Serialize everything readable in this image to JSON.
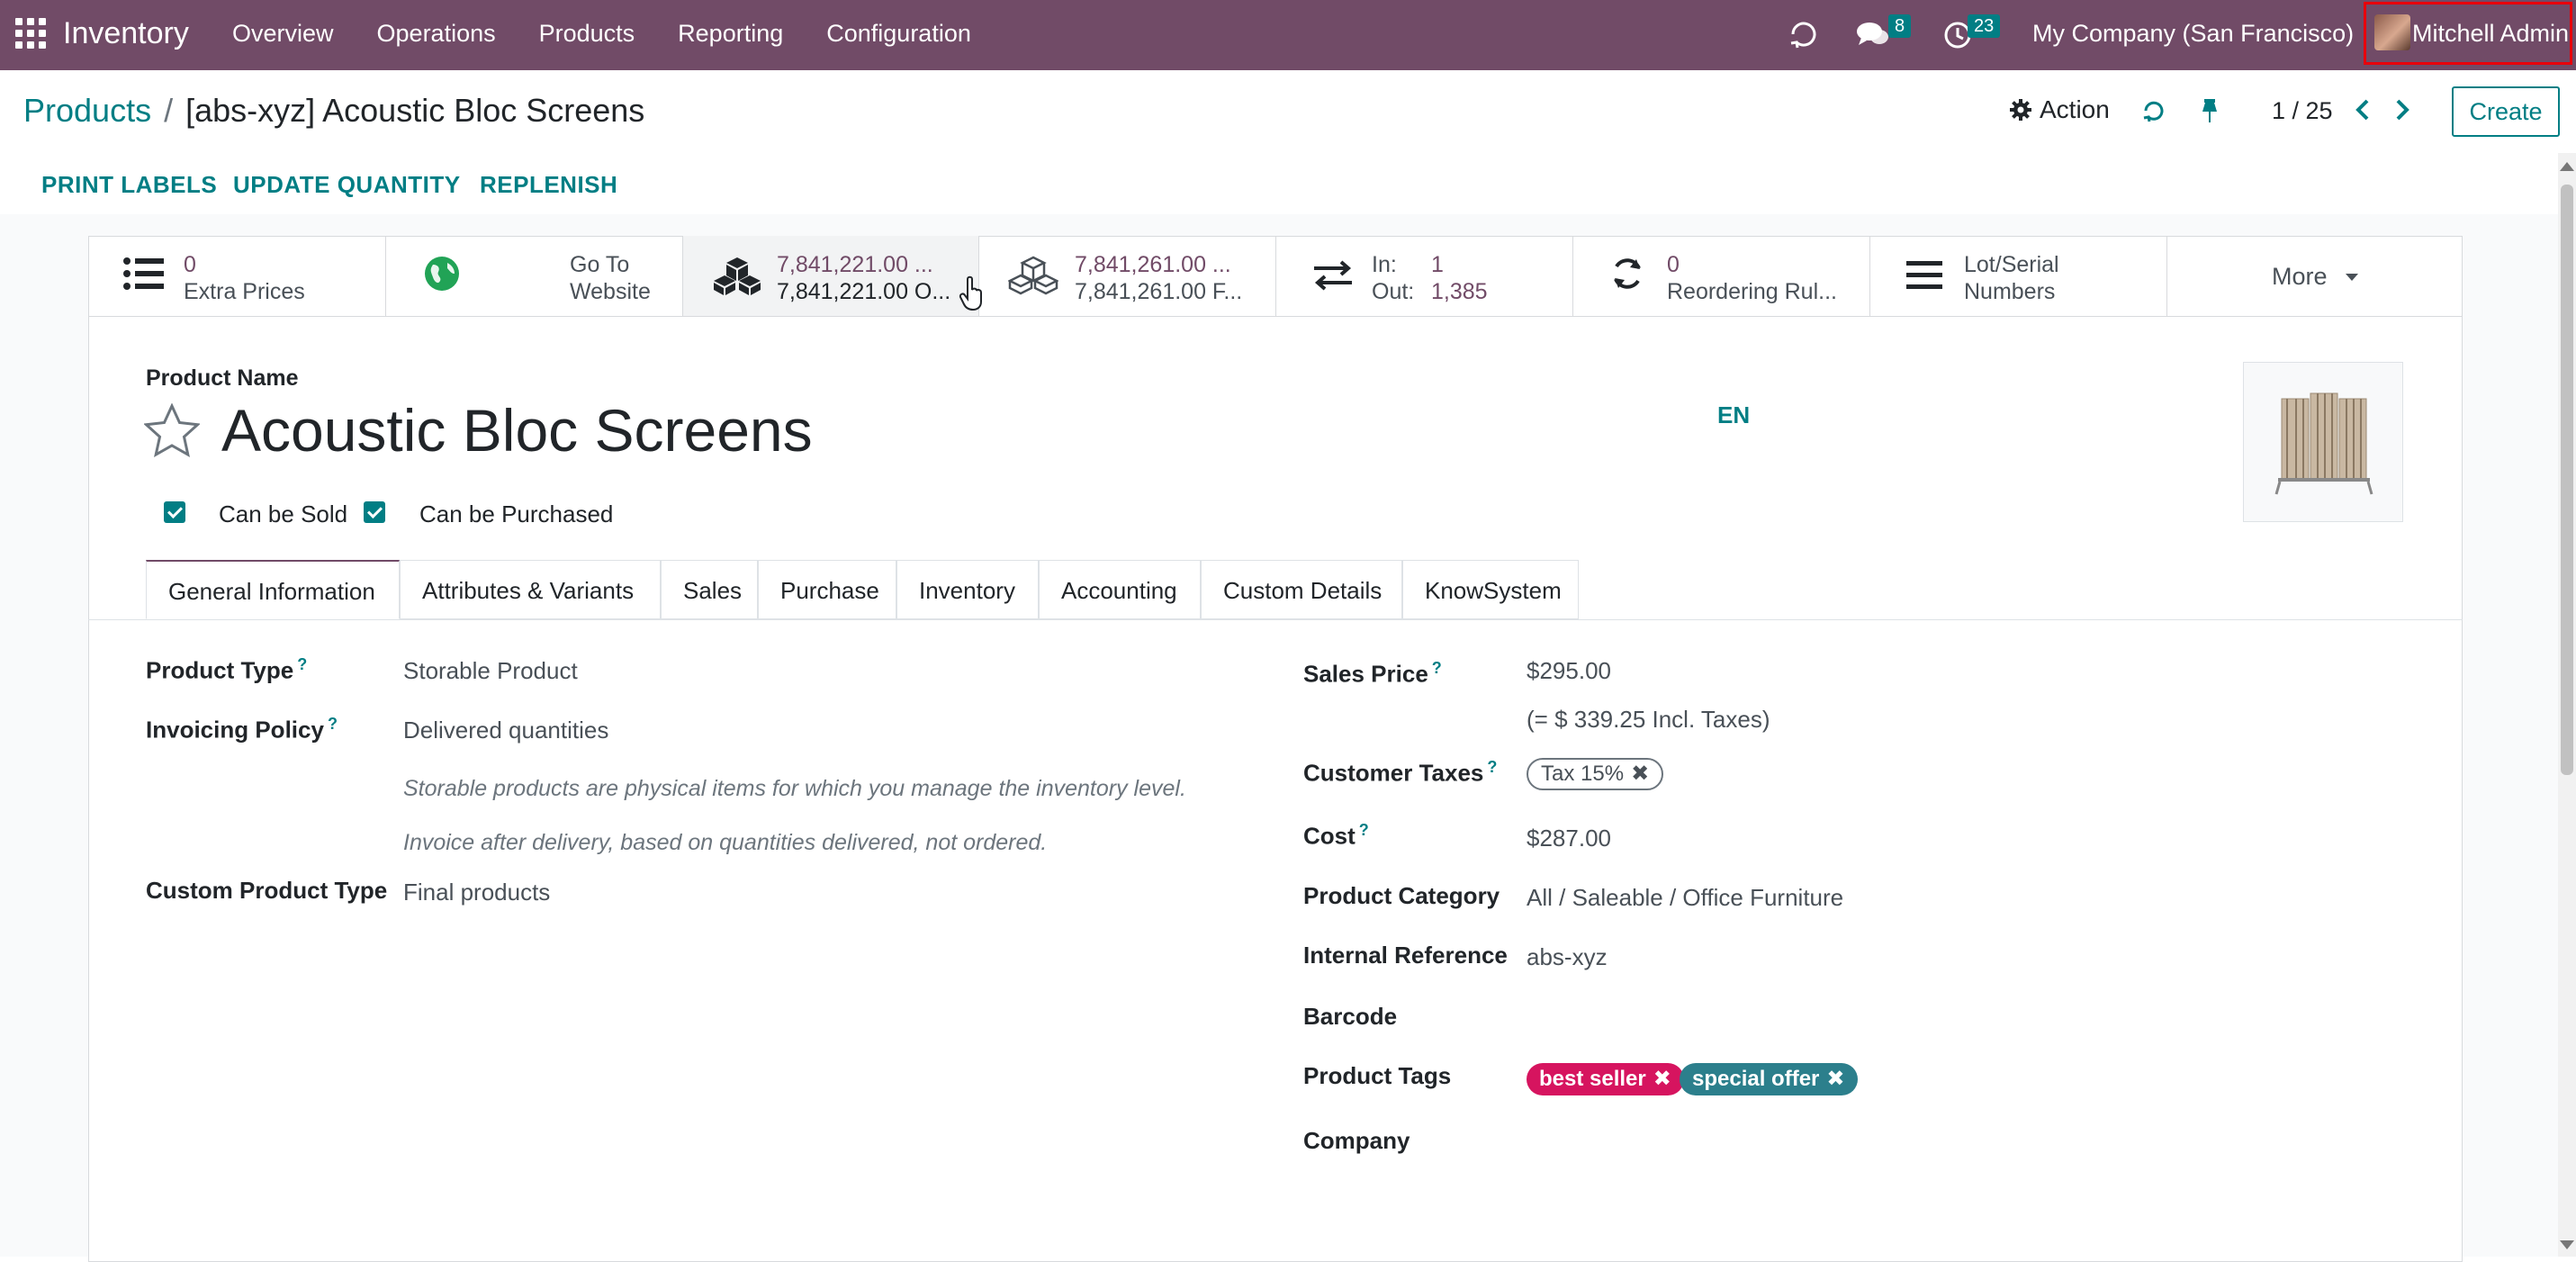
{
  "navbar": {
    "app_name": "Inventory",
    "menu": [
      "Overview",
      "Operations",
      "Products",
      "Reporting",
      "Configuration"
    ],
    "messages_count": "8",
    "activities_count": "23",
    "company": "My Company (San Francisco)",
    "user": "Mitchell Admin"
  },
  "control_panel": {
    "breadcrumb_parent": "Products",
    "breadcrumb_separator": "/",
    "breadcrumb_current": "[abs-xyz] Acoustic Bloc Screens",
    "action_label": "Action",
    "pager": "1 / 25",
    "create_label": "Create"
  },
  "header_buttons": [
    "PRINT LABELS",
    "UPDATE QUANTITY",
    "REPLENISH"
  ],
  "smart_buttons": {
    "extra_prices": {
      "value": "0",
      "label": "Extra Prices"
    },
    "website": {
      "line1": "Go To",
      "line2": "Website"
    },
    "on_hand": {
      "line1": "7,841,221.00 ...",
      "line2": "7,841,221.00 O..."
    },
    "forecasted": {
      "line1": "7,841,261.00 ...",
      "line2": "7,841,261.00 F..."
    },
    "in_out": {
      "in_label": "In:",
      "in_value": "1",
      "out_label": "Out:",
      "out_value": "1,385"
    },
    "reordering": {
      "value": "0",
      "label": "Reordering Rul..."
    },
    "lots": {
      "line1": "Lot/Serial",
      "line2": "Numbers"
    },
    "more": "More"
  },
  "product": {
    "name_label": "Product Name",
    "name": "Acoustic Bloc Screens",
    "lang": "EN",
    "can_be_sold": "Can be Sold",
    "can_be_purchased": "Can be Purchased"
  },
  "tabs": [
    "General Information",
    "Attributes & Variants",
    "Sales",
    "Purchase",
    "Inventory",
    "Accounting",
    "Custom Details",
    "KnowSystem"
  ],
  "general": {
    "product_type_label": "Product Type",
    "product_type": "Storable Product",
    "invoicing_policy_label": "Invoicing Policy",
    "invoicing_policy": "Delivered quantities",
    "help_storable": "Storable products are physical items for which you manage the inventory level.",
    "help_invoice": "Invoice after delivery, based on quantities delivered, not ordered.",
    "custom_type_label": "Custom Product Type",
    "custom_type": "Final products",
    "sales_price_label": "Sales Price",
    "sales_price": "$295.00",
    "incl_taxes": "(= $ 339.25 Incl. Taxes)",
    "customer_taxes_label": "Customer Taxes",
    "customer_tax": "Tax 15%",
    "cost_label": "Cost",
    "cost": "$287.00",
    "category_label": "Product Category",
    "category": "All / Saleable / Office Furniture",
    "internal_ref_label": "Internal Reference",
    "internal_ref": "abs-xyz",
    "barcode_label": "Barcode",
    "tags_label": "Product Tags",
    "tags": [
      "best seller",
      "special offer"
    ],
    "company_label": "Company",
    "help_mark": "?",
    "remove_mark": "✖"
  },
  "colors": {
    "brand": "#714B67",
    "accent": "#017E84",
    "tag_red": "#d6145f",
    "tag_teal": "#2c7f8c"
  }
}
